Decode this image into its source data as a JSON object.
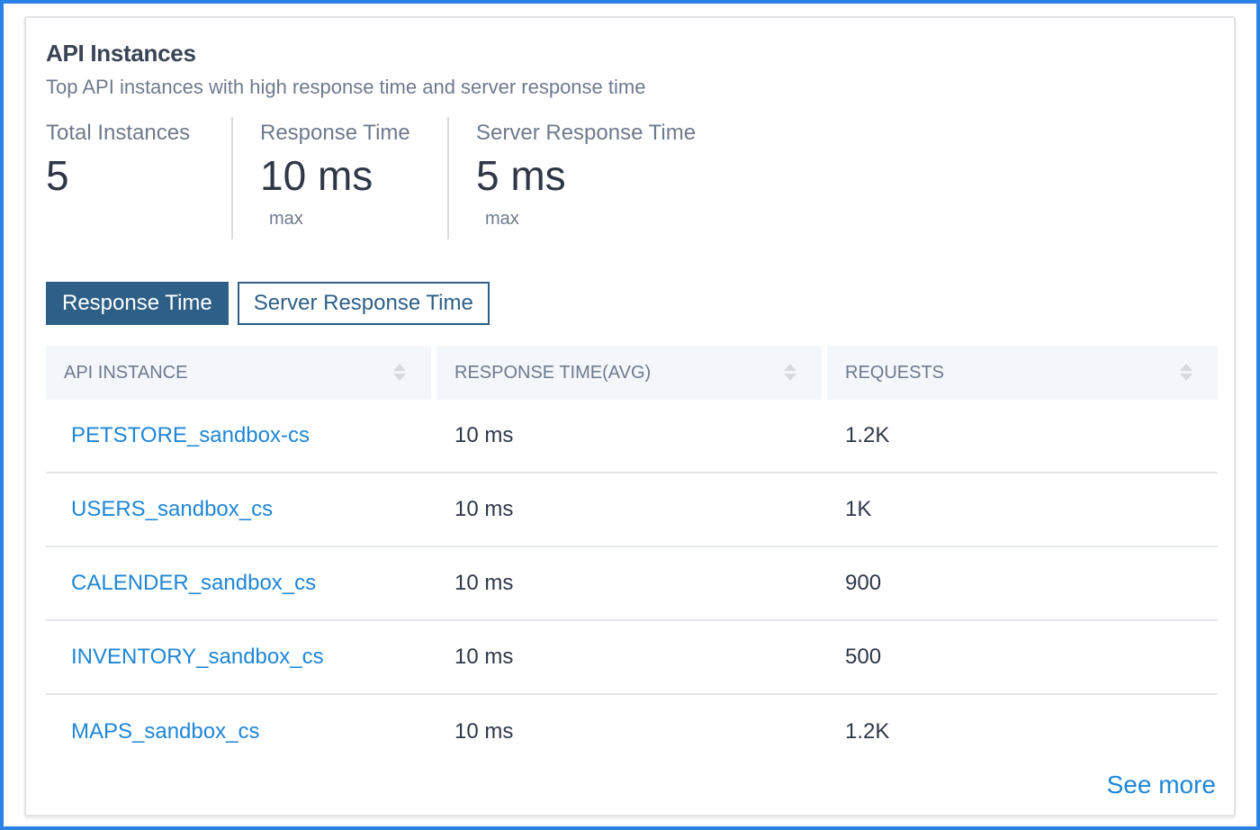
{
  "widget": {
    "title": "API Instances",
    "subtitle": "Top API instances with high response time and server response time"
  },
  "stats": [
    {
      "label": "Total Instances",
      "value": "5",
      "sub": ""
    },
    {
      "label": "Response Time",
      "value": "10 ms",
      "sub": "max"
    },
    {
      "label": "Server Response Time",
      "value": "5 ms",
      "sub": "max"
    }
  ],
  "tabs": [
    {
      "label": "Response Time",
      "active": true
    },
    {
      "label": "Server Response Time",
      "active": false
    }
  ],
  "table": {
    "columns": [
      "API INSTANCE",
      "RESPONSE TIME(AVG)",
      "REQUESTS"
    ],
    "rows": [
      {
        "instance": "PETSTORE_sandbox-cs",
        "response_time": "10 ms",
        "requests": "1.2K"
      },
      {
        "instance": "USERS_sandbox_cs",
        "response_time": "10 ms",
        "requests": "1K"
      },
      {
        "instance": "CALENDER_sandbox_cs",
        "response_time": "10 ms",
        "requests": "900"
      },
      {
        "instance": "INVENTORY_sandbox_cs",
        "response_time": "10 ms",
        "requests": "500"
      },
      {
        "instance": "MAPS_sandbox_cs",
        "response_time": "10 ms",
        "requests": "1.2K"
      }
    ]
  },
  "footer": {
    "see_more": "See more"
  },
  "colors": {
    "accent": "#2e5f87",
    "link": "#1f86d6",
    "frame": "#2b82e6"
  }
}
